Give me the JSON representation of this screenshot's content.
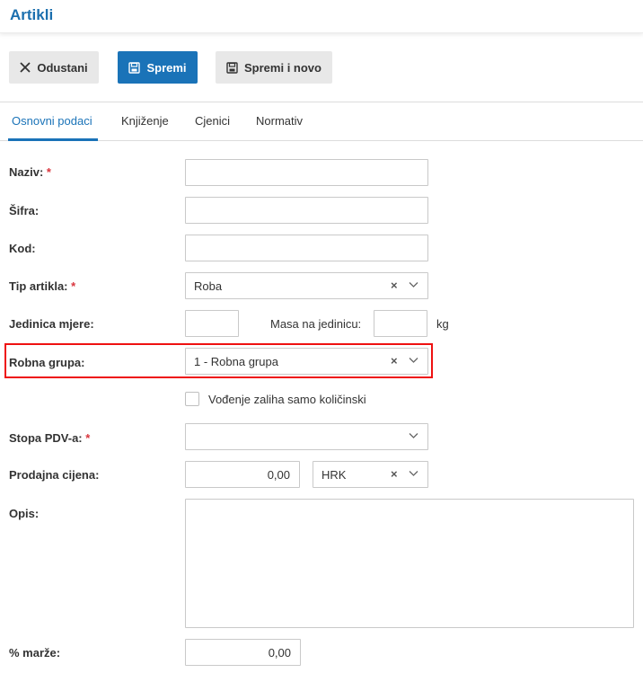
{
  "header": {
    "title": "Artikli"
  },
  "toolbar": {
    "cancel_label": "Odustani",
    "save_label": "Spremi",
    "save_new_label": "Spremi i novo"
  },
  "tabs": [
    {
      "label": "Osnovni podaci"
    },
    {
      "label": "Knjiženje"
    },
    {
      "label": "Cjenici"
    },
    {
      "label": "Normativ"
    }
  ],
  "form": {
    "required_mark": "*",
    "naziv": {
      "label": "Naziv:",
      "value": ""
    },
    "sifra": {
      "label": "Šifra:",
      "value": ""
    },
    "kod": {
      "label": "Kod:",
      "value": ""
    },
    "tip_artikla": {
      "label": "Tip artikla:",
      "value": "Roba"
    },
    "jedinica_mjere": {
      "label": "Jedinica mjere:",
      "value": ""
    },
    "masa": {
      "label": "Masa na jedinicu:",
      "value": "",
      "unit": "kg"
    },
    "robna_grupa": {
      "label": "Robna grupa:",
      "value": "1 - Robna grupa"
    },
    "vodjenje_zaliha": {
      "label": "Vođenje zaliha samo količinski",
      "checked": false
    },
    "stopa_pdv": {
      "label": "Stopa PDV-a:",
      "value": ""
    },
    "prodajna_cijena": {
      "label": "Prodajna cijena:",
      "value": "0,00",
      "currency": "HRK"
    },
    "opis": {
      "label": "Opis:",
      "value": ""
    },
    "marza": {
      "label": "% marže:",
      "value": "0,00"
    }
  },
  "colors": {
    "accent": "#1a73b8",
    "required": "#d9363e",
    "highlight": "#e11111"
  }
}
